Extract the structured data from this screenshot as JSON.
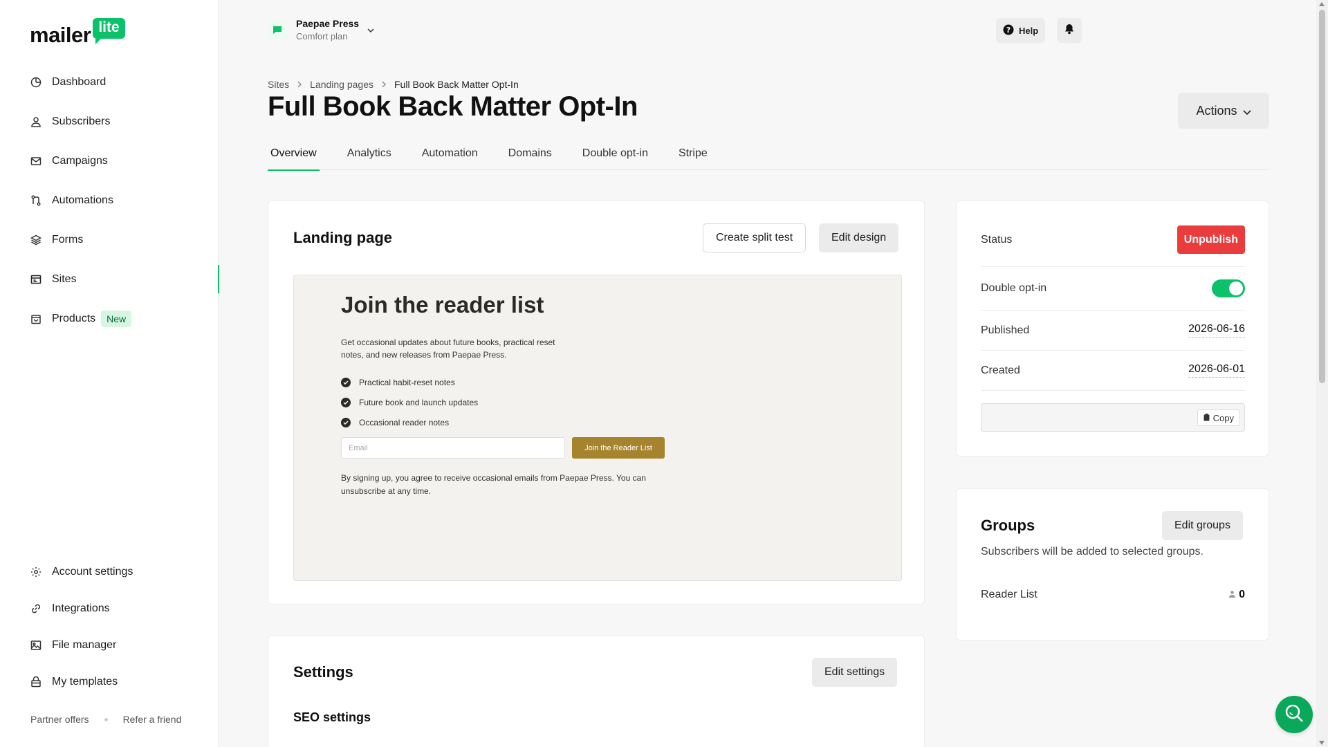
{
  "brand": {
    "logo_text": "mailer",
    "logo_badge": "lite",
    "accent": "#09c269"
  },
  "sidebar": {
    "items": [
      {
        "label": "Dashboard",
        "icon": "dashboard-icon"
      },
      {
        "label": "Subscribers",
        "icon": "user-icon"
      },
      {
        "label": "Campaigns",
        "icon": "mail-icon"
      },
      {
        "label": "Automations",
        "icon": "automation-icon"
      },
      {
        "label": "Forms",
        "icon": "layers-icon"
      },
      {
        "label": "Sites",
        "icon": "browser-icon",
        "active": true
      },
      {
        "label": "Products",
        "icon": "bag-icon",
        "badge": "New"
      }
    ],
    "bottom_items": [
      {
        "label": "Account settings",
        "icon": "gear-icon"
      },
      {
        "label": "Integrations",
        "icon": "link-icon"
      },
      {
        "label": "File manager",
        "icon": "image-icon"
      },
      {
        "label": "My templates",
        "icon": "template-icon"
      }
    ],
    "footer": {
      "partner": "Partner offers",
      "refer": "Refer a friend"
    }
  },
  "topbar": {
    "account_name": "Paepae Press",
    "account_plan": "Comfort plan",
    "help_label": "Help"
  },
  "header": {
    "breadcrumb": [
      "Sites",
      "Landing pages",
      "Full Book Back Matter Opt-In"
    ],
    "title": "Full Book Back Matter Opt-In",
    "actions_label": "Actions",
    "tabs": [
      "Overview",
      "Analytics",
      "Automation",
      "Domains",
      "Double opt-in",
      "Stripe"
    ],
    "active_tab": "Overview"
  },
  "landing_page": {
    "title": "Landing page",
    "split_test_label": "Create split test",
    "edit_design_label": "Edit design",
    "preview": {
      "heading": "Join the reader list",
      "description": "Get occasional updates about future books, practical reset notes, and new releases from Paepae Press.",
      "bullets": [
        "Practical habit-reset notes",
        "Future book and launch updates",
        "Occasional reader notes"
      ],
      "email_placeholder": "Email",
      "button_label": "Join the Reader List",
      "button_color": "#a6842d",
      "consent": "By signing up, you agree to receive occasional emails from Paepae Press. You can unsubscribe at any time."
    }
  },
  "settings": {
    "title": "Settings",
    "edit_label": "Edit settings",
    "seo_title": "SEO settings"
  },
  "status_card": {
    "status_label": "Status",
    "unpublish_label": "Unpublish",
    "unpublish_color": "#ea3c3c",
    "double_optin_label": "Double opt-in",
    "double_optin_on": true,
    "published_label": "Published",
    "published_value": "2026-06-16",
    "created_label": "Created",
    "created_value": "2026-06-01",
    "url_value": "",
    "copy_label": "Copy"
  },
  "groups_card": {
    "title": "Groups",
    "edit_label": "Edit groups",
    "description": "Subscribers will be added to selected groups.",
    "groups": [
      {
        "name": "Reader List",
        "count": "0"
      }
    ]
  }
}
